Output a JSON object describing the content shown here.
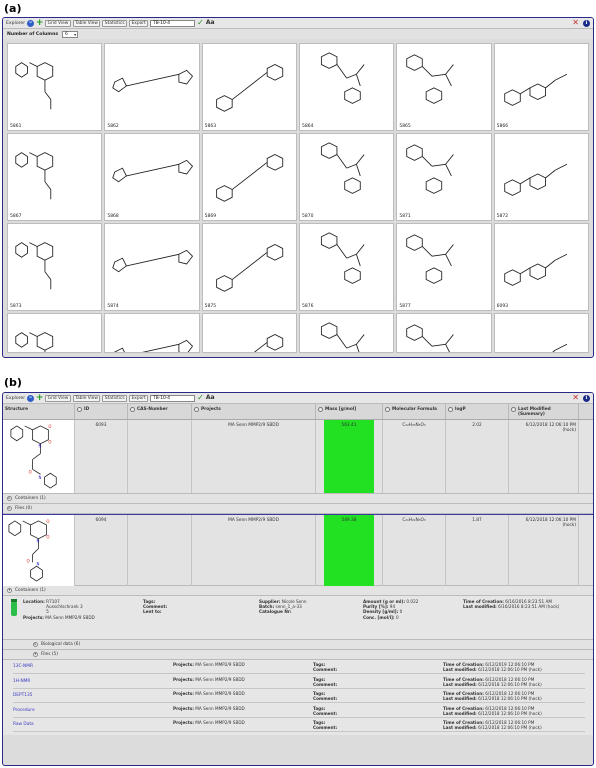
{
  "panel_a": {
    "label": "(a)",
    "toolbar": {
      "title": "Explorer",
      "btn_grid": "Grid View",
      "btn_table": "Table View",
      "btn_stats": "Statistics",
      "btn_export": "Export",
      "search_value": "TB-10-4"
    },
    "columns_label": "Number of Columns",
    "columns_value": "6",
    "cells": [
      {
        "id": "5861"
      },
      {
        "id": "5862"
      },
      {
        "id": "5863"
      },
      {
        "id": "5864"
      },
      {
        "id": "5865"
      },
      {
        "id": "5866"
      },
      {
        "id": "5867"
      },
      {
        "id": "5868"
      },
      {
        "id": "5869"
      },
      {
        "id": "5870"
      },
      {
        "id": "5871"
      },
      {
        "id": "5872"
      },
      {
        "id": "5873"
      },
      {
        "id": "5874"
      },
      {
        "id": "5875"
      },
      {
        "id": "5876"
      },
      {
        "id": "5877"
      },
      {
        "id": "6093"
      },
      {
        "id": ""
      },
      {
        "id": ""
      },
      {
        "id": ""
      },
      {
        "id": ""
      },
      {
        "id": ""
      },
      {
        "id": ""
      }
    ]
  },
  "panel_b": {
    "label": "(b)",
    "toolbar": {
      "title": "Explorer",
      "btn_grid": "Grid View",
      "btn_table": "Table View",
      "btn_stats": "Statistics",
      "btn_export": "Export",
      "search_value": "TB-10-4"
    },
    "headers": {
      "structure": "Structure",
      "id": "ID",
      "cas": "CAS-Number",
      "projects": "Projects",
      "mass": "Mass [g/mol]",
      "formula": "Molecular Formula",
      "logp": "logP",
      "modified": "Last Modified (Summary)"
    },
    "rows": [
      {
        "id": "6093",
        "projects": "MA Senn MMP2/9 SBDD",
        "mass": "563.41",
        "formula": "C₂₂H₂₃N₃O₃",
        "logp": "2.02",
        "modified": "6/12/2018 12:06:10 PM (hock)"
      },
      {
        "id": "6094",
        "projects": "MA Senn MMP2/9 SBDD",
        "mass": "549.38",
        "formula": "C₂₁H₂₁N₃O₃",
        "logp": "1.87",
        "modified": "6/12/2018 12:06:10 PM (hock)"
      }
    ],
    "row1_containers": "Containers (1)",
    "row1_files": "Files (0)",
    "row2_containers": "Containers (1)",
    "container": {
      "location_label": "Location:",
      "location_value": "R7107\nAusschlschrank 3\n5",
      "projects_label": "Projects:",
      "projects_value": "MA Senn MMP2/9 SBDD",
      "tags_label": "Tags:",
      "comment_label": "Comment:",
      "lentto_label": "Lent to:",
      "supplier_label": "Supplier:",
      "supplier_value": "Nicole Senn",
      "batch_label": "Batch:",
      "batch_value": "senn_1_a-33",
      "catalogue_label": "Catalogue Nr:",
      "amount_label": "Amount (g or ml):",
      "amount_value": "0.022",
      "purity_label": "Purity [%]:",
      "purity_value": "94",
      "density_label": "Density [g/ml]:",
      "density_value": "0",
      "conc_label": "Conc. [mol/l]:",
      "conc_value": "0",
      "creation_label": "Time of Creation:",
      "creation_value": "6/16/2016 8:23:51 AM",
      "modified_label": "Last modified:",
      "modified_value": "6/16/2016 8:23:51 AM (hock)"
    },
    "bio_data": "Biological data (6)",
    "files_label": "Files (5)",
    "files": [
      {
        "name": "13C-NMR",
        "projects": "MA Senn MMP2/9 SBDD",
        "creation": "6/12/2019 12:06:10 PM",
        "modified": "6/12/2018 12:06:10 PM (hock)"
      },
      {
        "name": "1H-NMR",
        "projects": "MA Senn MMP2/9 SBDD",
        "creation": "6/12/2018 12:06:10 PM",
        "modified": "6/12/2018 12:06:10 PM (hock)"
      },
      {
        "name": "DEPT135",
        "projects": "MA Senn MMP2/9 SBDD",
        "creation": "6/12/2018 12:06:10 PM",
        "modified": "6/12/2018 12:06:10 PM (hock)"
      },
      {
        "name": "Procedure",
        "projects": "MA Senn MMP2/9 SBDD",
        "creation": "6/12/2018 12:06:10 PM",
        "modified": "6/12/2018 12:06:10 PM (hock)"
      },
      {
        "name": "Raw Data",
        "projects": "MA Senn MMP2/9 SBDD",
        "creation": "6/12/2018 12:06:10 PM",
        "modified": "6/12/2018 12:06:10 PM (hock)"
      }
    ],
    "file_projects_label": "Projects:",
    "file_tags_label": "Tags:",
    "file_comment_label": "Comment:",
    "file_creation_label": "Time of Creation:",
    "file_modified_label": "Last modified:"
  }
}
